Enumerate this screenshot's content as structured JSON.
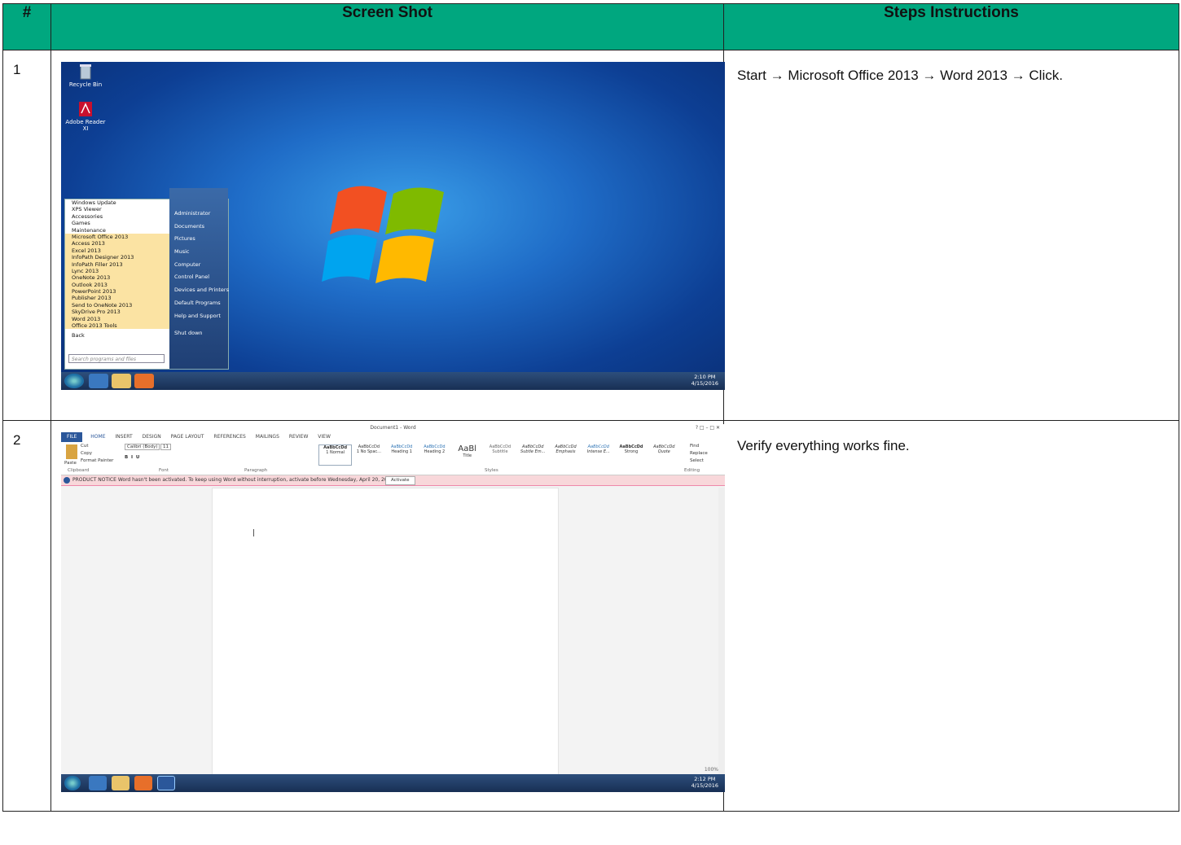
{
  "table": {
    "headers": [
      "#",
      "Screen Shot",
      "Steps Instructions"
    ],
    "header_color": "#00a77f",
    "rows": [
      {
        "num": "1",
        "instruction": "Start → Microsoft Office 2013 → Word 2013 → Click."
      },
      {
        "num": "2",
        "instruction": "Verify everything works fine."
      }
    ]
  },
  "desktop": {
    "icons": [
      {
        "label": "Recycle Bin",
        "icon": "recycle-bin-icon"
      },
      {
        "label": "Adobe Reader XI",
        "icon": "adobe-reader-icon"
      }
    ],
    "start_menu": {
      "programs": [
        "Windows Update",
        "XPS Viewer",
        "Accessories",
        "Games",
        "Maintenance",
        "Microsoft Office 2013",
        "Access 2013",
        "Excel 2013",
        "InfoPath Designer 2013",
        "InfoPath Filler 2013",
        "Lync 2013",
        "OneNote 2013",
        "Outlook 2013",
        "PowerPoint 2013",
        "Publisher 2013",
        "Send to OneNote 2013",
        "SkyDrive Pro 2013",
        "Word 2013",
        "Office 2013 Tools"
      ],
      "back_label": "Back",
      "search_placeholder": "Search programs and files",
      "right_items": [
        "Administrator",
        "Documents",
        "Pictures",
        "Music",
        "Computer",
        "Control Panel",
        "Devices and Printers",
        "Default Programs",
        "Help and Support"
      ],
      "shutdown_label": "Shut down"
    },
    "clock": {
      "time": "2:10 PM",
      "date": "4/15/2016"
    }
  },
  "word": {
    "title": "Document1 - Word",
    "tabs": [
      "FILE",
      "HOME",
      "INSERT",
      "DESIGN",
      "PAGE LAYOUT",
      "REFERENCES",
      "MAILINGS",
      "REVIEW",
      "VIEW"
    ],
    "clipboard": [
      "Paste",
      "Cut",
      "Copy",
      "Format Painter"
    ],
    "font": {
      "name": "Calibri (Body)",
      "size": "11"
    },
    "styles": [
      "1 Normal",
      "1 No Spac...",
      "Heading 1",
      "Heading 2",
      "Title",
      "Subtitle",
      "Subtle Em...",
      "Emphasis",
      "Intense E...",
      "Strong",
      "Quote"
    ],
    "style_sample": "AaBbCcDd",
    "group_labels": [
      "Clipboard",
      "Font",
      "Paragraph",
      "Styles",
      "Editing"
    ],
    "editing": [
      "Find",
      "Replace",
      "Select"
    ],
    "notice": "PRODUCT NOTICE  Word hasn't been activated. To keep using Word without interruption, activate before Wednesday, April 20, 2016.",
    "activate_label": "Activate",
    "zoom": "100%",
    "clock": {
      "time": "2:12 PM",
      "date": "4/15/2016"
    }
  }
}
